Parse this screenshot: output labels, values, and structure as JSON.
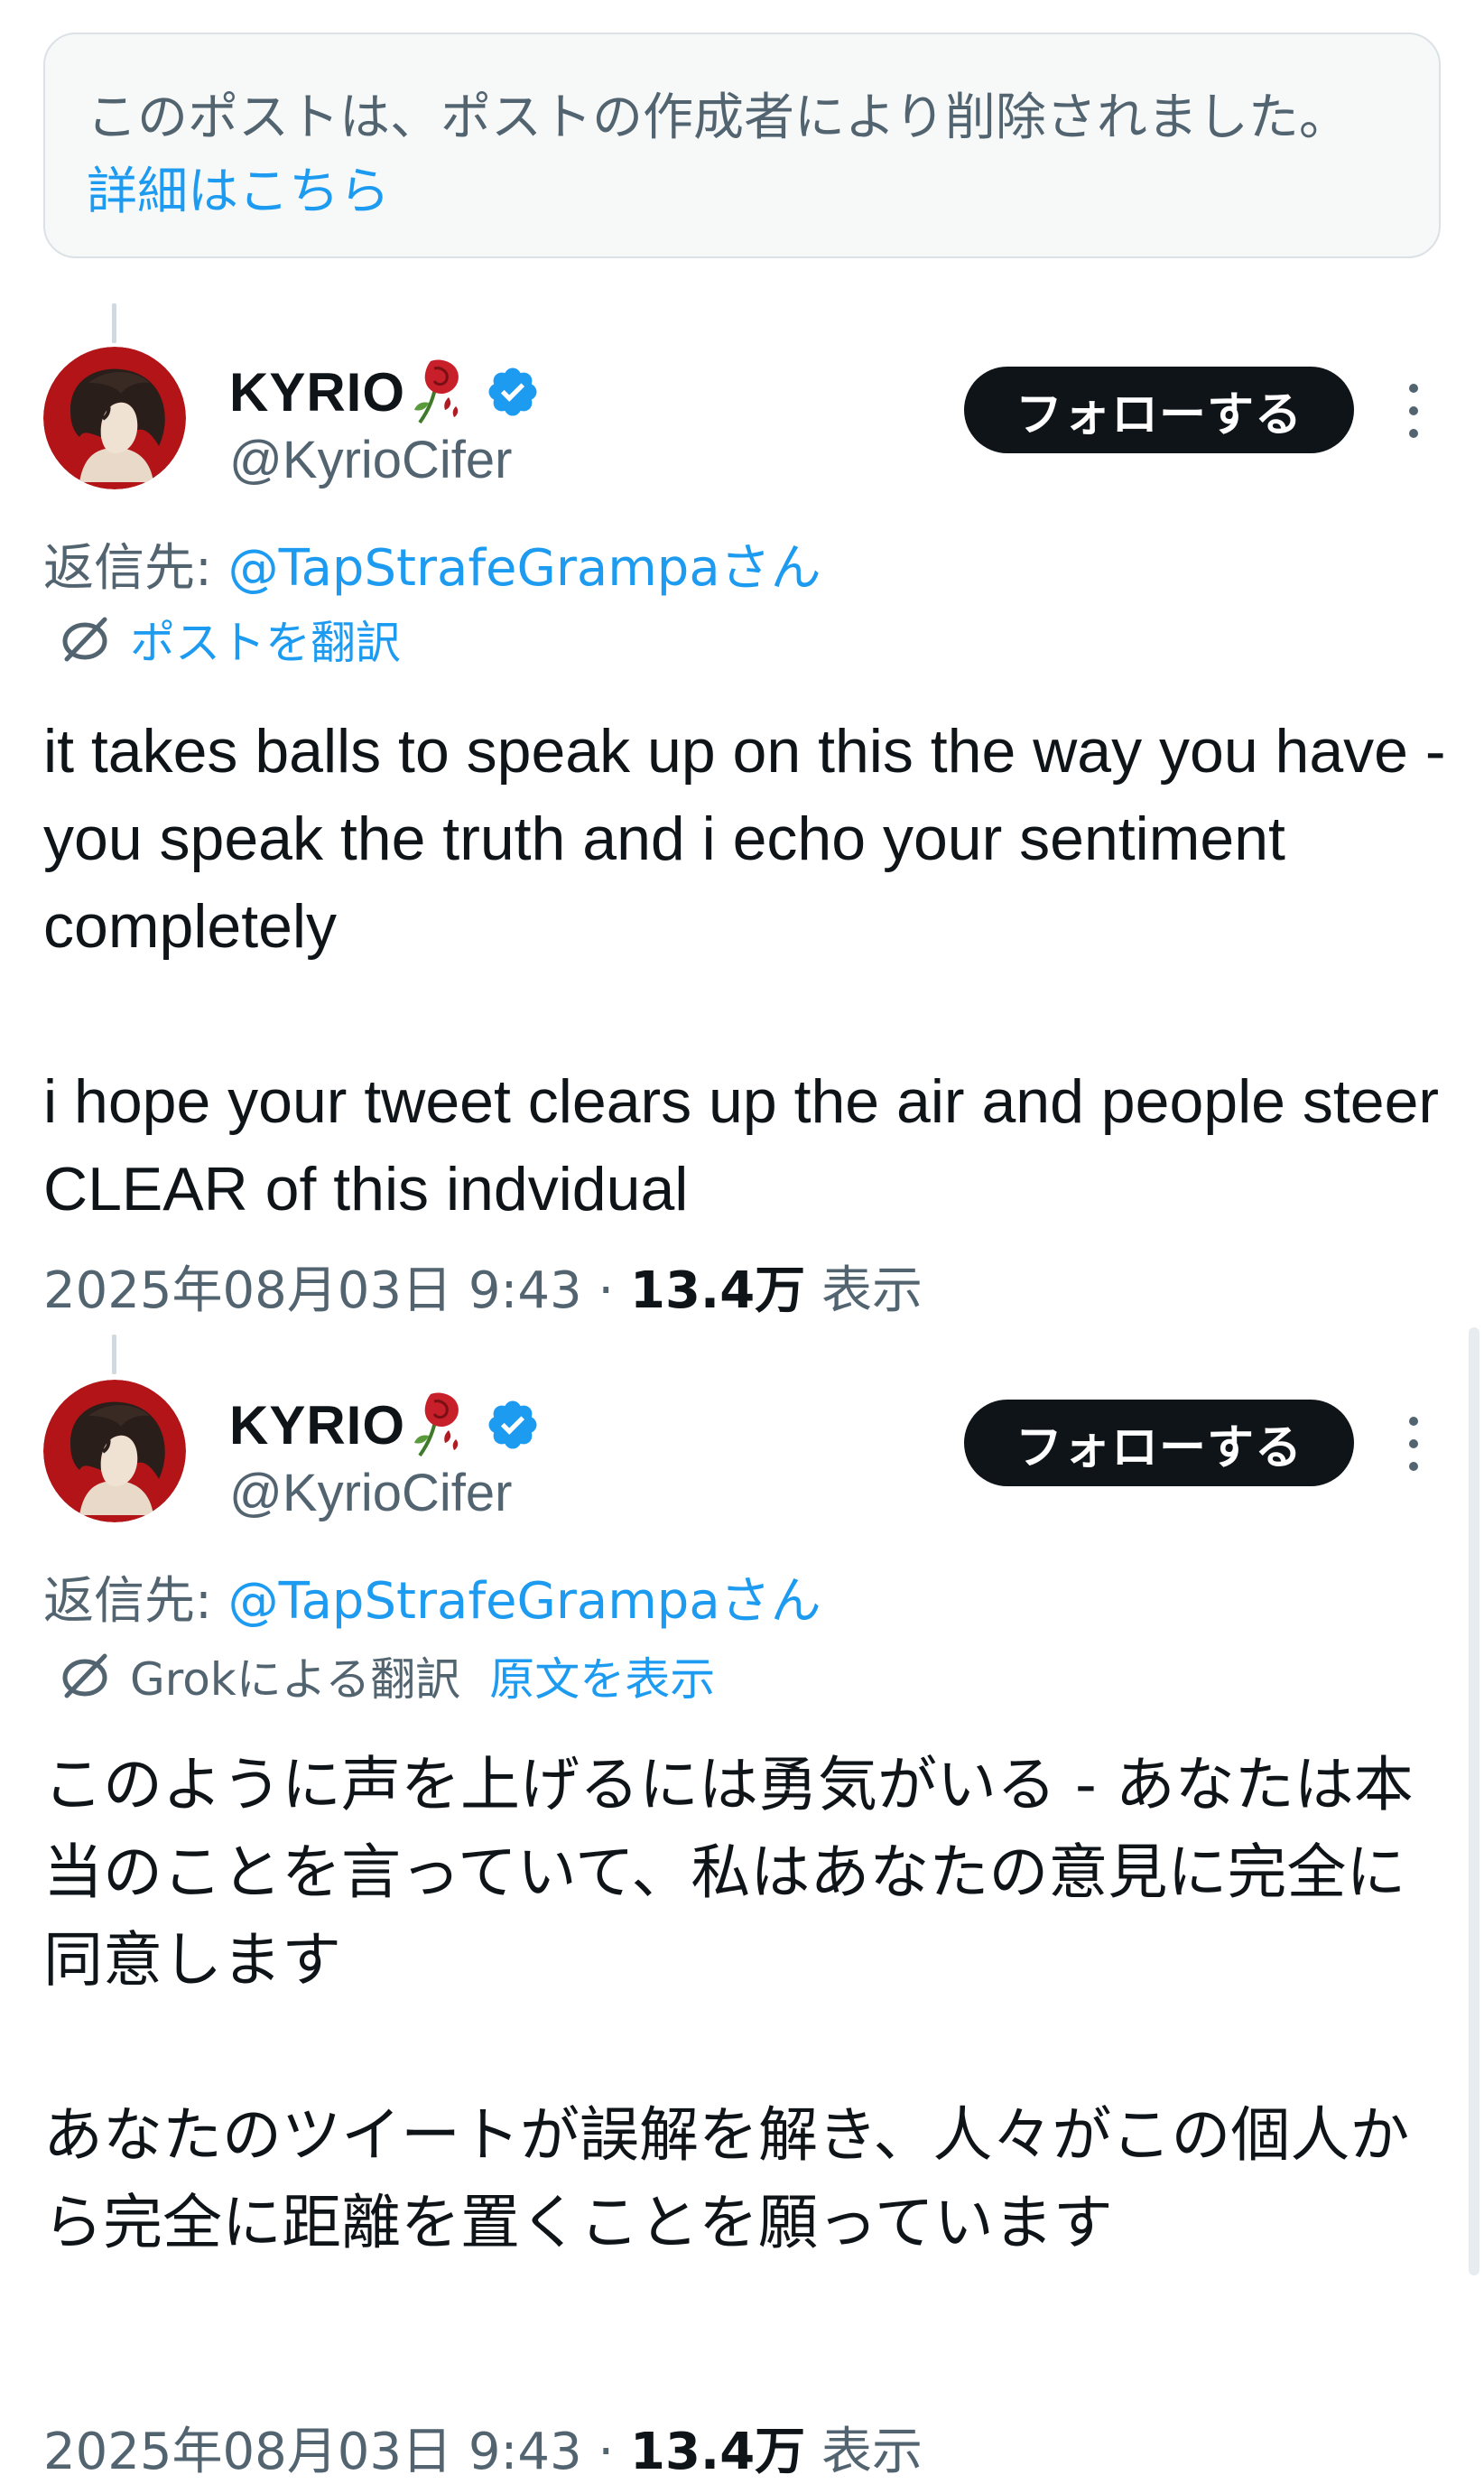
{
  "deleted_notice": {
    "text": "このポストは、ポストの作成者により削除されました。",
    "link": "詳細はこちら"
  },
  "posts": [
    {
      "author": {
        "name": "KYRIO",
        "handle": "@KyrioCifer",
        "verified": true
      },
      "follow_label": "フォローする",
      "reply_prefix": "返信先: ",
      "reply_mention": "@TapStrafeGrampaさん",
      "translate": {
        "label": "ポストを翻訳",
        "action": ""
      },
      "body": "it takes balls to speak up on this the way you have - you speak the truth and i echo your sentiment completely\n\ni hope your tweet clears up the air and people steer CLEAR of this indvidual",
      "timestamp": "2025年08月03日 9:43 · ",
      "views_count": "13.4万",
      "views_label": " 表示"
    },
    {
      "author": {
        "name": "KYRIO",
        "handle": "@KyrioCifer",
        "verified": true
      },
      "follow_label": "フォローする",
      "reply_prefix": "返信先: ",
      "reply_mention": "@TapStrafeGrampaさん",
      "translate": {
        "label": "Grokによる翻訳",
        "action": "原文を表示"
      },
      "body": "このように声を上げるには勇気がいる - あなたは本当のことを言っていて、私はあなたの意見に完全に同意します\n\nあなたのツイートが誤解を解き、人々がこの個人から完全に距離を置くことを願っています",
      "timestamp": "2025年08月03日 9:43 · ",
      "views_count": "13.4万",
      "views_label": " 表示"
    }
  ],
  "icons": {
    "verified": "verified-badge-icon",
    "rose": "wilted-rose-emoji",
    "globe": "translate-globe-icon",
    "more": "more-dots-icon"
  },
  "colors": {
    "accent": "#1d9bf0",
    "text": "#0f1419",
    "muted": "#536471",
    "button": "#0f1419"
  }
}
